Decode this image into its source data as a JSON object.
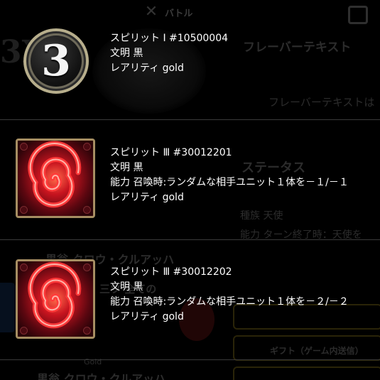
{
  "background": {
    "nav_label": "バトル",
    "big_number": "3X",
    "flavor_title": "フレーバーテキスト",
    "flavor_body": "フレーバーテキストは",
    "status_heading": "ステータス",
    "race_line": "種族 天使",
    "ability_line": "能力 ターン終了時：天使を",
    "card_name": "黒翁 クロウ・クルアッハ",
    "card_sub": "三ツ 全ての",
    "gold_label": "Gold",
    "card_name2": "黒翁 クロウ・クルアッハ",
    "gift_button_label": "ギフト（ゲーム内送信）"
  },
  "items": [
    {
      "icon": "number-3-badge-icon",
      "badge_text": "3",
      "title": "スピリット Ⅰ #10500004",
      "civilization": "文明 黒",
      "ability": null,
      "rarity": "レアリティ gold"
    },
    {
      "icon": "red-swirl-card-icon",
      "badge_text": null,
      "title": "スピリット Ⅲ #30012201",
      "civilization": "文明 黒",
      "ability": "能力 召喚時:ランダムな相手ユニット１体を－１/－１",
      "rarity": "レアリティ gold"
    },
    {
      "icon": "red-swirl-card-icon",
      "badge_text": null,
      "title": "スピリット Ⅲ #30012202",
      "civilization": "文明 黒",
      "ability": "能力 召喚時:ランダムな相手ユニット１体を－２/－２",
      "rarity": "レアリティ gold"
    }
  ],
  "colors": {
    "background": "#000000",
    "text": "#ffffff",
    "divider": "#3a3a3a",
    "icon_frame_gold": "#a68e62",
    "swirl_red": "#e8202a"
  }
}
